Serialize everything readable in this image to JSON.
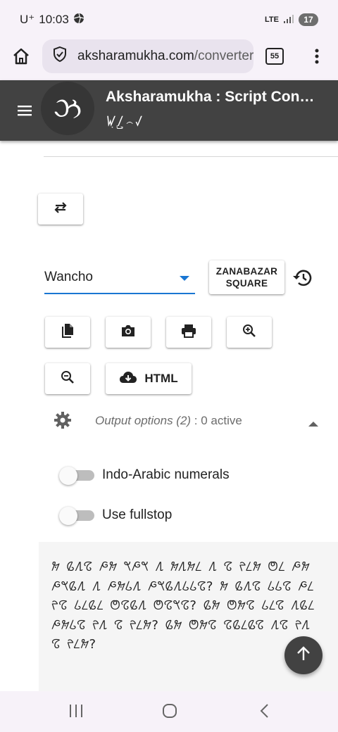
{
  "status_bar": {
    "carrier": "U⁺",
    "time": "10:03",
    "network": "LTE",
    "battery": "17"
  },
  "browser": {
    "url_host": "aksharamukha.com",
    "url_path": "/converter",
    "tab_count": "55"
  },
  "app": {
    "title": "Aksharamukha : Script Converter",
    "subtitle": "ꤿ꤫ꤷ꤬꤮ꤶ",
    "logo_glyph": "ઝ"
  },
  "converter": {
    "target_script": "Wancho",
    "suggested_button": "ZANABAZAR\nSQUARE",
    "options_label": "Output options (2)",
    "options_active": " : 0 active",
    "toggles": [
      {
        "label": "Indo-Arabic numerals",
        "on": false
      },
      {
        "label": "Use fullstop",
        "on": false
      }
    ],
    "html_button": "HTML",
    "output_text": "𞋁 𞋂𞋊𞋘 𞋃𞋁 𞋈𞋃𞋈 𞋊 𞋁𞋊𞋁𞋉 𞋊 𞋘 𞋐𞋉𞋁 𞋇𞋉 𞋃𞋁 𞋃𞋈𞋂𞋊 𞋊 𞋃𞋁𞋅𞋊 𞋃𞋈𞋂𞋊𞋅𞋅𞋘? 𞋁 𞋂𞋊𞋘 𞋅𞋅𞋘 𞋃𞋉 𞋐𞋘 𞋅𞋉𞋂𞋉 𞋇𞋘𞋂𞋊 𞋇𞋘𞋈𞋘? 𞋂𞋁 𞋇𞋁𞋘 𞋅𞋉𞋘 𞋊𞋂𞋉 𞋃𞋁𞋅𞋘 𞋐𞋊 𞋘 𞋐𞋉𞋁? 𞋂𞋁 𞋇𞋁𞋘 𞋘𞋂𞋉𞋂𞋘 𞋊𞋘 𞋐𞋊 𞋘 𞋐𞋉𞋁?"
  },
  "colors": {
    "appbar": "#424242",
    "accent": "#1976d2"
  }
}
